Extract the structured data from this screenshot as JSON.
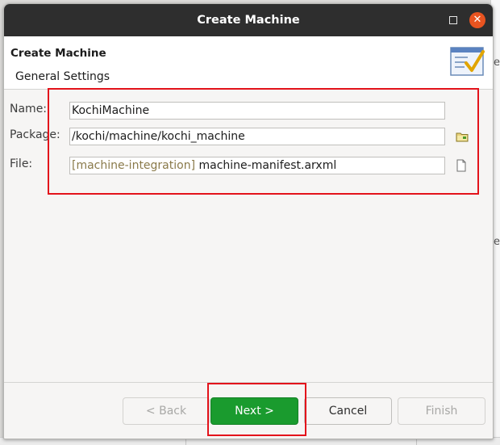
{
  "window": {
    "title": "Create Machine"
  },
  "banner": {
    "title": "Create Machine",
    "subtitle": "General Settings"
  },
  "form": {
    "name_label": "Name:",
    "name_value": "KochiMachine",
    "package_label": "Package:",
    "package_value": "/kochi/machine/kochi_machine",
    "file_label": "File:",
    "file_prefix": "[machine-integration]",
    "file_value": "machine-manifest.arxml"
  },
  "buttons": {
    "back": "< Back",
    "next": "Next >",
    "cancel": "Cancel",
    "finish": "Finish"
  },
  "background": {
    "char1": "e",
    "char2": "e"
  },
  "colors": {
    "titlebar": "#2e2e2e",
    "close": "#e95420",
    "next_button": "#1a9b2e",
    "highlight": "#e3131b",
    "file_prefix": "#8a7a4a"
  },
  "icons": {
    "banner": "wizard-checklist-icon",
    "package_browse": "folder-icon",
    "file_browse": "file-icon"
  }
}
